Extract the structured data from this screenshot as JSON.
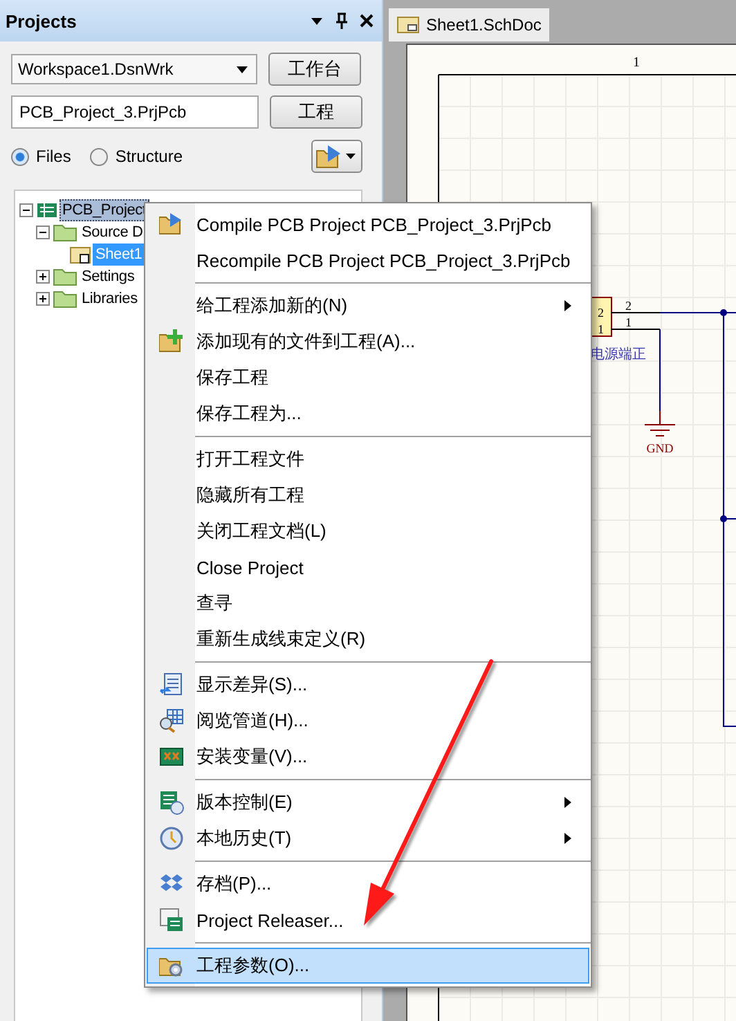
{
  "panel": {
    "title": "Projects",
    "workspace": {
      "value": "Workspace1.DsnWrk",
      "button": "工作台"
    },
    "project": {
      "value": "PCB_Project_3.PrjPcb",
      "button": "工程"
    },
    "views": [
      {
        "label": "Files",
        "selected": true
      },
      {
        "label": "Structure",
        "selected": false
      }
    ],
    "tree": [
      {
        "label": "PCB_Project",
        "kind": "project",
        "expanded": true,
        "selected": false,
        "context_target": true,
        "children": [
          {
            "label": "Source D",
            "kind": "folder",
            "expanded": true,
            "selected": false,
            "context_target": false,
            "children": [
              {
                "label": "Sheet1",
                "kind": "sheet",
                "selected": true,
                "context_target": false
              }
            ]
          },
          {
            "label": "Settings",
            "kind": "folder",
            "expanded": false,
            "selected": false,
            "context_target": false
          },
          {
            "label": "Libraries",
            "kind": "folder",
            "expanded": false,
            "selected": false,
            "context_target": false
          }
        ]
      }
    ]
  },
  "document": {
    "tabs": [
      {
        "label": "Sheet1.SchDoc",
        "selected": true
      }
    ],
    "schematic": {
      "border_label": "1",
      "part_pins": [
        "2",
        "1"
      ],
      "wire_pins": [
        "2",
        "1"
      ],
      "part_label": "电源端正",
      "power_label": "GND"
    }
  },
  "context_menu": {
    "groups": [
      [
        {
          "label": "Compile PCB Project PCB_Project_3.PrjPcb",
          "submenu": false,
          "selected": false
        },
        {
          "label": "Recompile PCB Project PCB_Project_3.PrjPcb",
          "submenu": false,
          "selected": false
        }
      ],
      [
        {
          "label": "给工程添加新的(N)",
          "submenu": true,
          "selected": false
        },
        {
          "label": "添加现有的文件到工程(A)...",
          "submenu": false,
          "selected": false
        },
        {
          "label": "保存工程",
          "submenu": false,
          "selected": false
        },
        {
          "label": "保存工程为...",
          "submenu": false,
          "selected": false
        }
      ],
      [
        {
          "label": "打开工程文件",
          "submenu": false,
          "selected": false
        },
        {
          "label": "隐藏所有工程",
          "submenu": false,
          "selected": false
        },
        {
          "label": "关闭工程文档(L)",
          "submenu": false,
          "selected": false
        },
        {
          "label": "Close Project",
          "submenu": false,
          "selected": false
        },
        {
          "label": "查寻",
          "submenu": false,
          "selected": false
        },
        {
          "label": "重新生成线束定义(R)",
          "submenu": false,
          "selected": false
        }
      ],
      [
        {
          "label": "显示差异(S)...",
          "submenu": false,
          "selected": false
        },
        {
          "label": "阅览管道(H)...",
          "submenu": false,
          "selected": false
        },
        {
          "label": "安装变量(V)...",
          "submenu": false,
          "selected": false
        }
      ],
      [
        {
          "label": "版本控制(E)",
          "submenu": true,
          "selected": false
        },
        {
          "label": "本地历史(T)",
          "submenu": true,
          "selected": false
        }
      ],
      [
        {
          "label": "存档(P)...",
          "submenu": false,
          "selected": false
        },
        {
          "label": "Project Releaser...",
          "submenu": false,
          "selected": false
        }
      ],
      [
        {
          "label": "工程参数(O)...",
          "submenu": false,
          "selected": true
        }
      ]
    ]
  }
}
